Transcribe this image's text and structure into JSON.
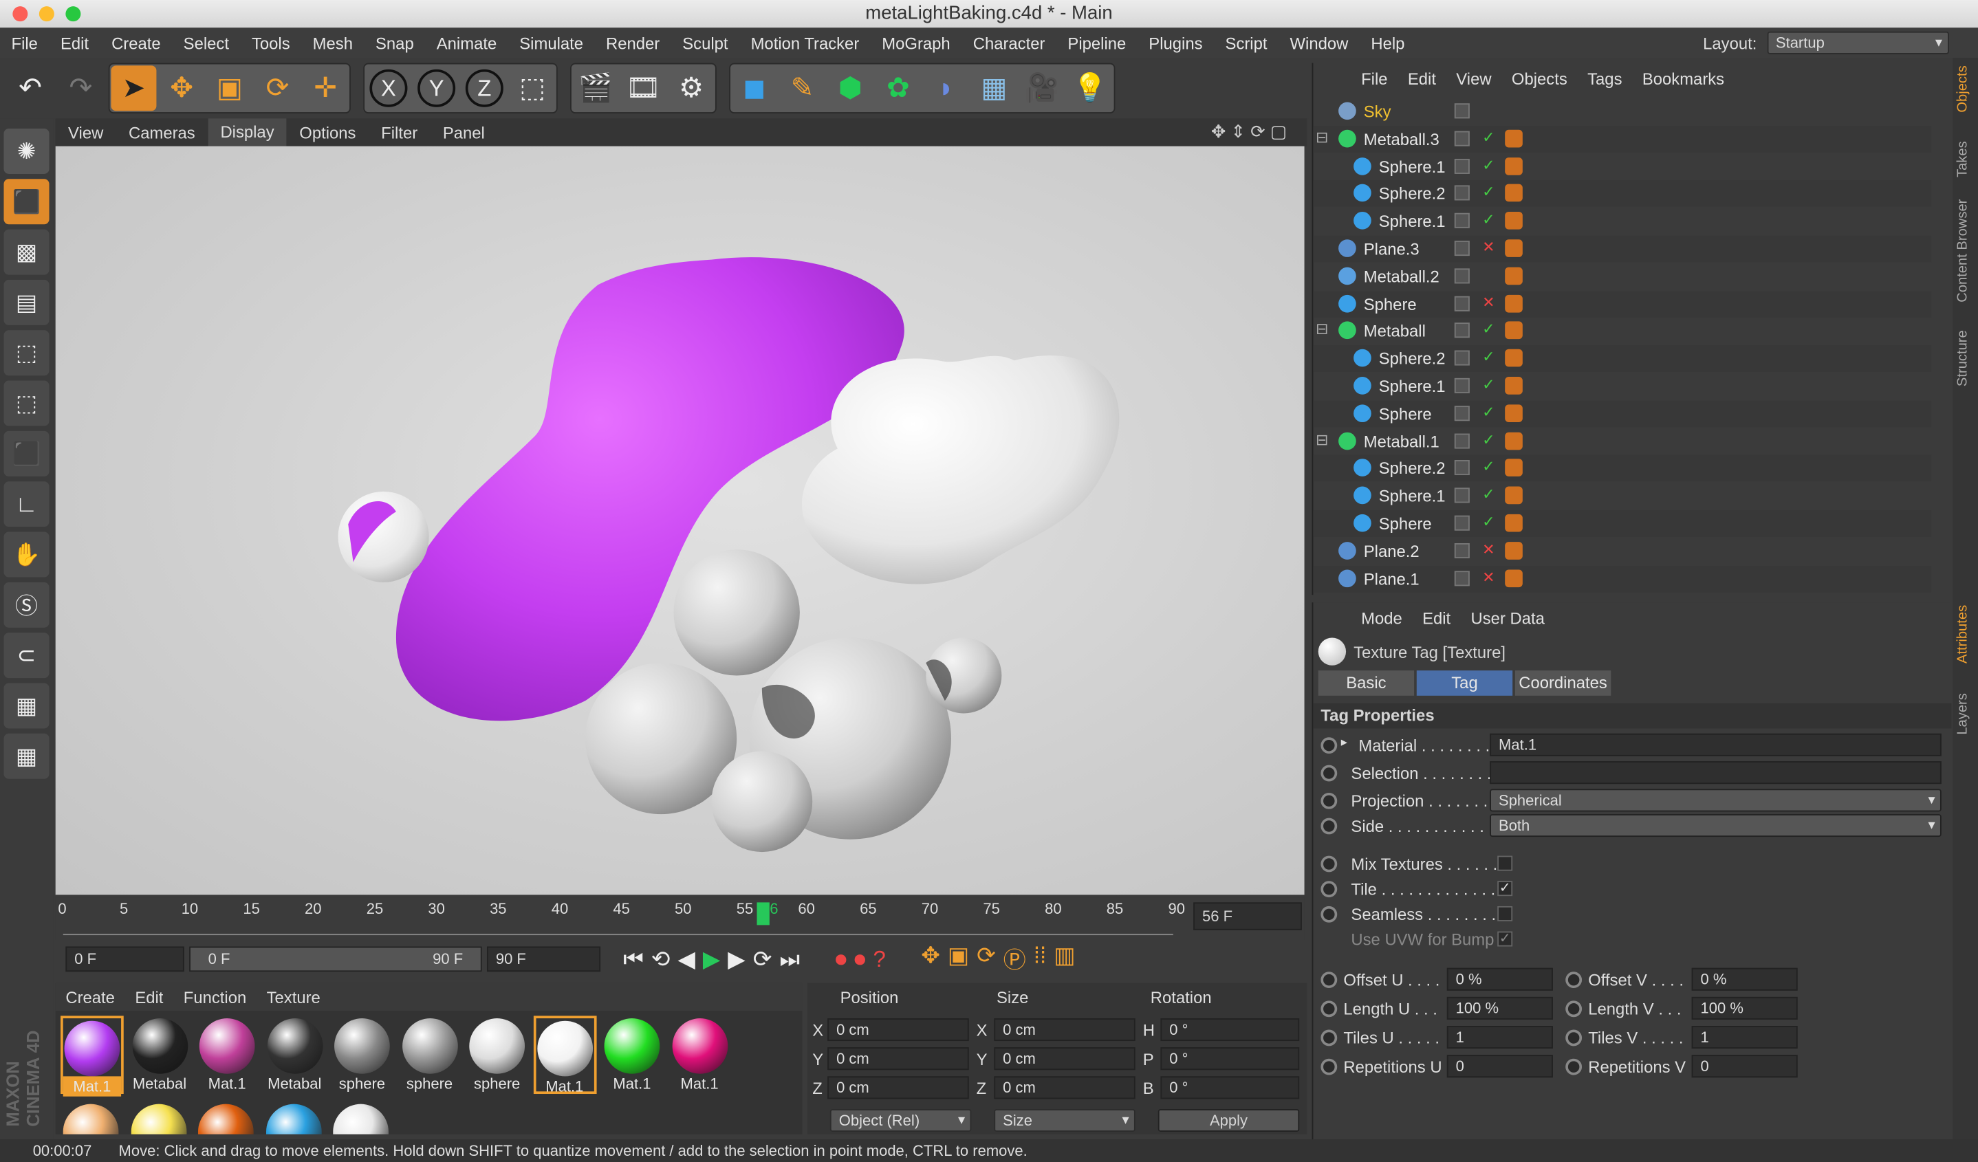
{
  "window": {
    "title": "metaLightBaking.c4d * - Main"
  },
  "menu": [
    "File",
    "Edit",
    "Create",
    "Select",
    "Tools",
    "Mesh",
    "Snap",
    "Animate",
    "Simulate",
    "Render",
    "Sculpt",
    "Motion Tracker",
    "MoGraph",
    "Character",
    "Pipeline",
    "Plugins",
    "Script",
    "Window",
    "Help"
  ],
  "layout": {
    "label": "Layout:",
    "value": "Startup"
  },
  "toolbar": {
    "axis_x": "X",
    "axis_y": "Y",
    "axis_z": "Z"
  },
  "viewport": {
    "menu": [
      "View",
      "Cameras",
      "Display",
      "Options",
      "Filter",
      "Panel"
    ],
    "active": "Display"
  },
  "timeline": {
    "ticks": [
      "0",
      "5",
      "10",
      "15",
      "20",
      "25",
      "30",
      "35",
      "40",
      "45",
      "50",
      "55",
      "56",
      "60",
      "65",
      "70",
      "75",
      "80",
      "85",
      "90"
    ],
    "current_frame": "56 F",
    "start": "0 F",
    "range_start": "0 F",
    "range_end": "90 F",
    "end": "90 F",
    "progress": 0.62
  },
  "materials": {
    "menu": [
      "Create",
      "Edit",
      "Function",
      "Texture"
    ],
    "items": [
      {
        "label": "Mat.1",
        "color": "#b23cf0"
      },
      {
        "label": "Metabal",
        "color": "#222"
      },
      {
        "label": "Mat.1",
        "color": "#c0409a"
      },
      {
        "label": "Metabal",
        "color": "#333"
      },
      {
        "label": "sphere",
        "color": "#888"
      },
      {
        "label": "sphere",
        "color": "#999"
      },
      {
        "label": "sphere",
        "color": "#ddd"
      },
      {
        "label": "Mat.1",
        "color": "#f2f2f2"
      },
      {
        "label": "Mat.1",
        "color": "#22dd22"
      },
      {
        "label": "Mat.1",
        "color": "#e0107a"
      }
    ],
    "row2": [
      "#f0b070",
      "#f5e050",
      "#e06010",
      "#2aa0e0",
      "#e8e8e8"
    ]
  },
  "coords": {
    "headers": [
      "Position",
      "Size",
      "Rotation"
    ],
    "rows": [
      {
        "a": "X",
        "pos": "0 cm",
        "b": "X",
        "size": "0 cm",
        "c": "H",
        "rot": "0 °"
      },
      {
        "a": "Y",
        "pos": "0 cm",
        "b": "Y",
        "size": "0 cm",
        "c": "P",
        "rot": "0 °"
      },
      {
        "a": "Z",
        "pos": "0 cm",
        "b": "Z",
        "size": "0 cm",
        "c": "B",
        "rot": "0 °"
      }
    ],
    "mode": "Object (Rel)",
    "size_mode": "Size",
    "apply": "Apply"
  },
  "status": {
    "time": "00:00:07",
    "text": "Move: Click and drag to move elements. Hold down SHIFT to quantize movement / add to the selection in point mode, CTRL to remove."
  },
  "objects": {
    "menu": [
      "File",
      "Edit",
      "View",
      "Objects",
      "Tags",
      "Bookmarks"
    ],
    "rows": [
      {
        "name": "Sky",
        "indent": 0,
        "icon": "sky",
        "x": false
      },
      {
        "name": "Metaball.3",
        "indent": 0,
        "icon": "meta",
        "x": false
      },
      {
        "name": "Sphere.1",
        "indent": 1,
        "icon": "sphere",
        "x": false
      },
      {
        "name": "Sphere.2",
        "indent": 1,
        "icon": "sphere",
        "x": false
      },
      {
        "name": "Sphere.1",
        "indent": 1,
        "icon": "sphere",
        "x": false
      },
      {
        "name": "Plane.3",
        "indent": 0,
        "icon": "plane",
        "x": true
      },
      {
        "name": "Metaball.2",
        "indent": 0,
        "icon": "meta2",
        "x": false
      },
      {
        "name": "Sphere",
        "indent": 0,
        "icon": "sphere",
        "x": true
      },
      {
        "name": "Metaball",
        "indent": 0,
        "icon": "meta",
        "x": false
      },
      {
        "name": "Sphere.2",
        "indent": 1,
        "icon": "sphere",
        "x": false
      },
      {
        "name": "Sphere.1",
        "indent": 1,
        "icon": "sphere",
        "x": false
      },
      {
        "name": "Sphere",
        "indent": 1,
        "icon": "sphere",
        "x": false
      },
      {
        "name": "Metaball.1",
        "indent": 0,
        "icon": "meta",
        "x": false
      },
      {
        "name": "Sphere.2",
        "indent": 1,
        "icon": "sphere",
        "x": false
      },
      {
        "name": "Sphere.1",
        "indent": 1,
        "icon": "sphere",
        "x": false
      },
      {
        "name": "Sphere",
        "indent": 1,
        "icon": "sphere",
        "x": false
      },
      {
        "name": "Plane.2",
        "indent": 0,
        "icon": "plane",
        "x": true
      },
      {
        "name": "Plane.1",
        "indent": 0,
        "icon": "plane",
        "x": true
      }
    ]
  },
  "attributes": {
    "menu": [
      "Mode",
      "Edit",
      "User Data"
    ],
    "title": "Texture Tag [Texture]",
    "tabs": [
      "Basic",
      "Tag",
      "Coordinates"
    ],
    "active_tab": "Tag",
    "section": "Tag Properties",
    "material": {
      "label": "Material . . . . . . . .",
      "value": "Mat.1"
    },
    "selection": {
      "label": "Selection . . . . . . . .",
      "value": ""
    },
    "projection": {
      "label": "Projection . . . . . . .",
      "value": "Spherical"
    },
    "side": {
      "label": "Side . . . . . . . . . . . . .",
      "value": "Both"
    },
    "mix": {
      "label": "Mix Textures . . . . . ."
    },
    "tile": {
      "label": "Tile . . . . . . . . . . . . . .",
      "check": "✓"
    },
    "seamless": {
      "label": "Seamless . . . . . . . . ."
    },
    "uvw": {
      "label": "Use UVW for Bump",
      "check": "✓"
    },
    "offset_u": {
      "label": "Offset U . . . .",
      "value": "0 %"
    },
    "offset_v": {
      "label": "Offset V . . . .",
      "value": "0 %"
    },
    "length_u": {
      "label": "Length U . . .",
      "value": "100 %"
    },
    "length_v": {
      "label": "Length V . . .",
      "value": "100 %"
    },
    "tiles_u": {
      "label": "Tiles U . . . . .",
      "value": "1"
    },
    "tiles_v": {
      "label": "Tiles V . . . . .",
      "value": "1"
    },
    "rep_u": {
      "label": "Repetitions U",
      "value": "0"
    },
    "rep_v": {
      "label": "Repetitions V",
      "value": "0"
    }
  },
  "side_tabs": [
    "Objects",
    "Takes",
    "Content Browser",
    "Structure",
    "Attributes",
    "Layers"
  ],
  "brand": {
    "line1": "MAXON",
    "line2": "CINEMA 4D"
  }
}
